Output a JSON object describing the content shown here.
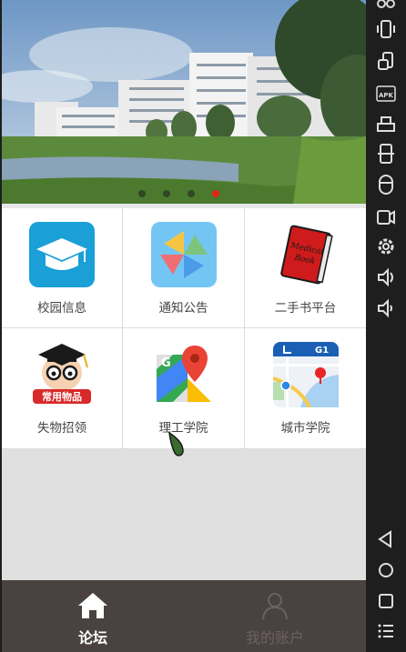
{
  "banner": {
    "slide_count": 4,
    "active_slide_index": 3,
    "accent": "#e2231a"
  },
  "grid": {
    "items": [
      {
        "label": "校园信息",
        "icon": "graduation-cap-icon"
      },
      {
        "label": "通知公告",
        "icon": "pinwheel-icon"
      },
      {
        "label": "二手书平台",
        "icon": "medical-book-icon"
      },
      {
        "label": "失物招领",
        "icon": "common-items-mascot-icon"
      },
      {
        "label": "理工学院",
        "icon": "maps-pin-icon"
      },
      {
        "label": "城市学院",
        "icon": "city-map-icon"
      }
    ],
    "medical_book_text_1": "Medical",
    "medical_book_text_2": "Book",
    "common_items_tag": "常用物品",
    "city_map_road": "G1"
  },
  "tabbar": {
    "tabs": [
      {
        "label": "论坛",
        "icon": "home-icon",
        "active": true
      },
      {
        "label": "我的账户",
        "icon": "user-icon",
        "active": false
      }
    ],
    "background": "#4a4241"
  },
  "toolbar": {
    "apk_label": "APK",
    "buttons": [
      "scissors-icon",
      "vibrate-icon",
      "rotate-icon",
      "apk-install-icon",
      "ruler-icon",
      "screenshot-icon",
      "mouse-icon",
      "video-record-icon",
      "settings-icon",
      "volume-up-icon",
      "volume-down-icon",
      "back-icon",
      "home-circle-icon",
      "recents-icon",
      "menu-icon"
    ]
  }
}
